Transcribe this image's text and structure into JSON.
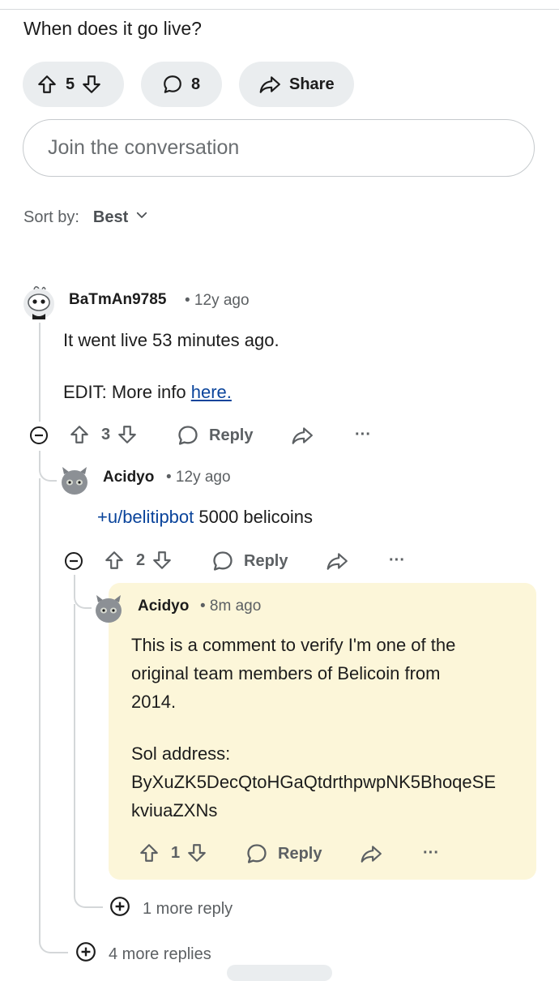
{
  "post": {
    "title": "When does it go live?",
    "vote_count": "5",
    "comment_count": "8",
    "share_label": "Share",
    "join_placeholder": "Join the conversation"
  },
  "sort": {
    "label": "Sort by:",
    "value": "Best"
  },
  "comments": [
    {
      "author": "BaTmAn9785",
      "time": "• 12y ago",
      "body_line1": "It went live 53 minutes ago.",
      "body_line2_prefix": "EDIT: More info ",
      "body_line2_link": "here.",
      "votes": "3",
      "reply_label": "Reply",
      "more_label": "···"
    },
    {
      "author": "Acidyo",
      "time": "• 12y ago",
      "body_link": "+u/belitipbot",
      "body_rest": " 5000 belicoins",
      "votes": "2",
      "reply_label": "Reply",
      "more_label": "···"
    },
    {
      "author": "Acidyo",
      "time": "• 8m ago",
      "body_lines": [
        "This is a comment to verify I'm one of the",
        "original team members of Belicoin from",
        "2014.",
        "",
        "Sol address:",
        "ByXuZK5DecQtoHGaQtdrthpwpNK5BhoqeSE",
        "kviuaZXNs"
      ],
      "votes": "1",
      "reply_label": "Reply",
      "more_label": "···"
    }
  ],
  "more_reply": "1 more reply",
  "more_replies": "4 more replies",
  "colors": {
    "highlight": "#fcf6d9",
    "link": "#0a449b",
    "pill": "#eaedef"
  }
}
